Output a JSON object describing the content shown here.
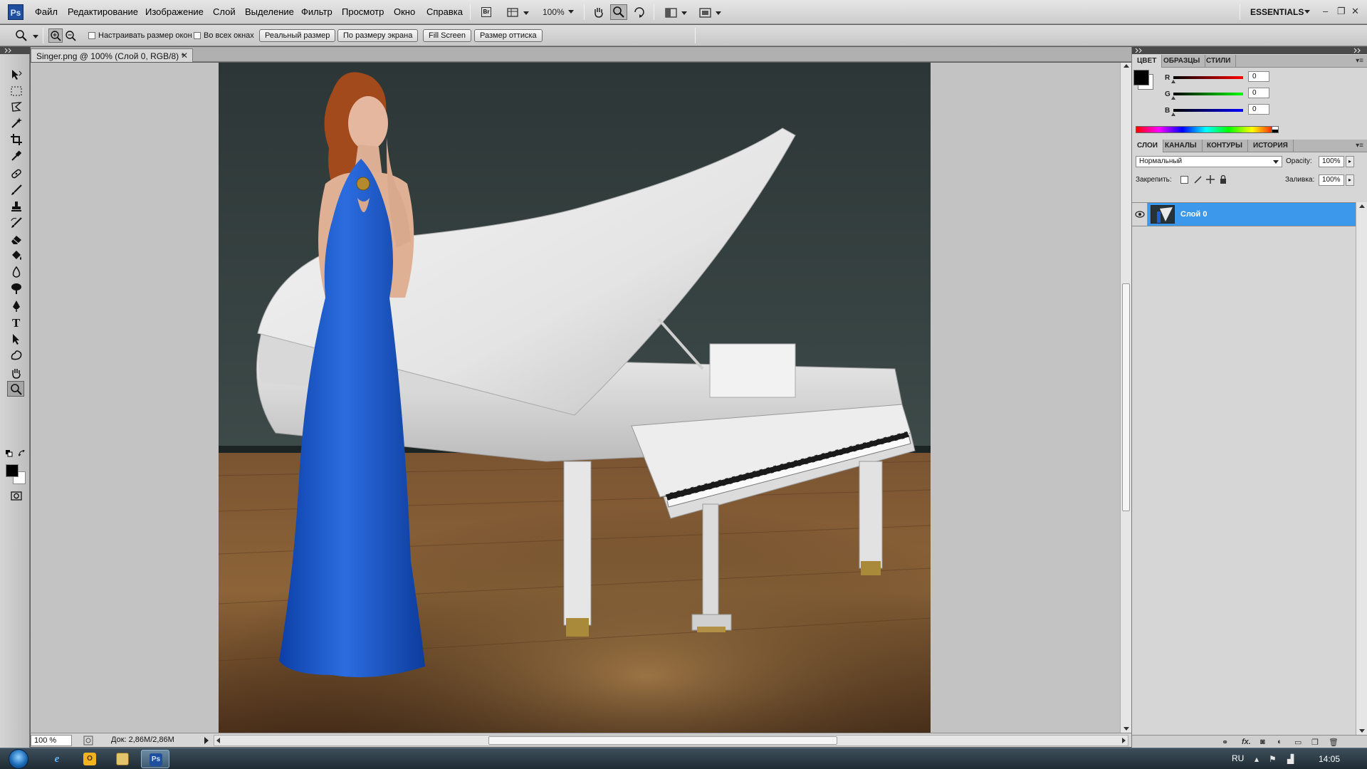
{
  "app": {
    "logo": "Ps"
  },
  "menu": [
    "Файл",
    "Редактирование",
    "Изображение",
    "Слой",
    "Выделение",
    "Фильтр",
    "Просмотр",
    "Окно",
    "Справка"
  ],
  "menubar": {
    "bridge_label": "Br",
    "zoom_level": "100%",
    "workspace": "ESSENTIALS"
  },
  "window_controls": {
    "minimize": "–",
    "restore": "❐",
    "close": "✕"
  },
  "options": {
    "resize_windows": "Настраивать размер окон",
    "all_windows": "Во всех окнах",
    "actual_pixels": "Реальный размер",
    "fit_screen": "По размеру экрана",
    "fill_screen": "Fill Screen",
    "print_size": "Размер оттиска"
  },
  "tools": [
    "move-tool",
    "marquee-tool",
    "lasso-tool",
    "magic-wand-tool",
    "crop-tool",
    "eyedropper-tool",
    "healing-brush-tool",
    "brush-tool",
    "clone-stamp-tool",
    "history-brush-tool",
    "eraser-tool",
    "paint-bucket-tool",
    "blur-tool",
    "dodge-tool",
    "pen-tool",
    "type-tool",
    "path-selection-tool",
    "shape-tool",
    "hand-tool",
    "zoom-tool"
  ],
  "document": {
    "tab_title": "Singer.png @ 100% (Слой 0, RGB/8) *",
    "zoom": "100 %",
    "doc_info": "Док: 2,86M/2,86M"
  },
  "color_panel": {
    "tabs": [
      "ЦВЕТ",
      "ОБРАЗЦЫ",
      "СТИЛИ"
    ],
    "r_label": "R",
    "g_label": "G",
    "b_label": "B",
    "r": "0",
    "g": "0",
    "b": "0",
    "foreground": "#000000",
    "background": "#ffffff"
  },
  "layers_panel": {
    "tabs": [
      "СЛОИ",
      "КАНАЛЫ",
      "КОНТУРЫ",
      "ИСТОРИЯ"
    ],
    "blend_mode": "Нормальный",
    "opacity_label": "Opacity:",
    "opacity": "100%",
    "lock_label": "Закрепить:",
    "fill_label": "Заливка:",
    "fill": "100%",
    "layers": [
      {
        "name": "Слой 0",
        "selected": true,
        "visible": true
      }
    ]
  },
  "taskbar": {
    "language": "RU",
    "clock": "14:05",
    "photoshop_label": "Ps"
  },
  "colors": {
    "selection": "#3c98ea",
    "canvas_bg": "#c3c3c3",
    "ps_blue": "#1f4f9e"
  }
}
